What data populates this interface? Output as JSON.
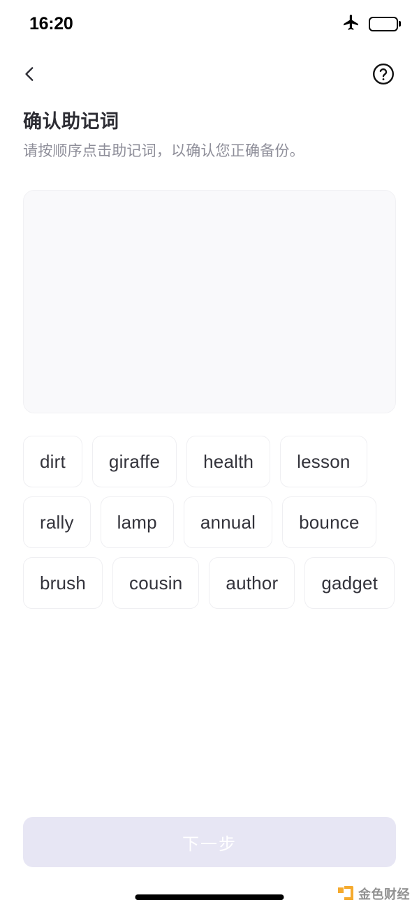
{
  "status_bar": {
    "time": "16:20",
    "airplane_icon": "airplane-mode-icon",
    "battery_icon": "battery-low-power-icon",
    "battery_level_percent": 45,
    "battery_color": "#fdc927"
  },
  "nav_bar": {
    "back_icon": "chevron-left-icon",
    "help_icon": "question-mark-circle-icon"
  },
  "header": {
    "title": "确认助记词",
    "subtitle": "请按顺序点击助记词，以确认您正确备份。"
  },
  "selection_area": {
    "selected_words": [],
    "background_color": "#f9f9fb"
  },
  "word_pool": {
    "words": [
      "dirt",
      "giraffe",
      "health",
      "lesson",
      "rally",
      "lamp",
      "annual",
      "bounce",
      "brush",
      "cousin",
      "author",
      "gadget"
    ]
  },
  "footer": {
    "next_label": "下一步",
    "next_disabled": true,
    "next_color": "#e7e6f4"
  },
  "watermark": {
    "text": "金色财经",
    "accent_color": "#f5a623"
  }
}
